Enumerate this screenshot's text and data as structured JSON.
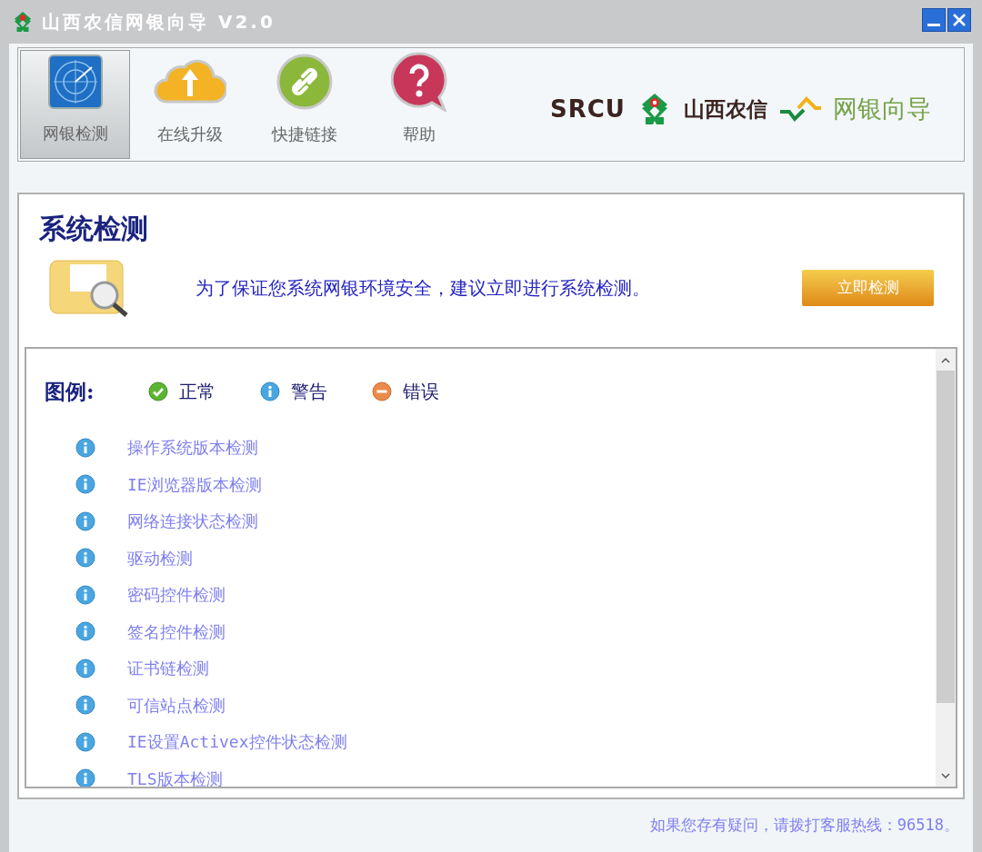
{
  "window": {
    "title": "山西农信网银向导 V2.0"
  },
  "tabs": [
    {
      "label": "网银检测",
      "selected": true,
      "kind": "radar"
    },
    {
      "label": "在线升级",
      "selected": false,
      "kind": "cloud"
    },
    {
      "label": "快捷链接",
      "selected": false,
      "kind": "link"
    },
    {
      "label": "帮助",
      "selected": false,
      "kind": "help"
    }
  ],
  "logo": {
    "brand": "SRCU",
    "name": "山西农信",
    "product": "网银向导"
  },
  "section": {
    "title": "系统检测",
    "message": "为了保证您系统网银环境安全，建议立即进行系统检测。",
    "button": "立即检测"
  },
  "legend": {
    "label": "图例:",
    "items": [
      {
        "kind": "ok",
        "label": "正常"
      },
      {
        "kind": "warning",
        "label": "警告"
      },
      {
        "kind": "error",
        "label": "错误"
      }
    ]
  },
  "checks": [
    {
      "kind": "warning",
      "label": "操作系统版本检测"
    },
    {
      "kind": "warning",
      "label": "IE浏览器版本检测"
    },
    {
      "kind": "warning",
      "label": "网络连接状态检测"
    },
    {
      "kind": "warning",
      "label": "驱动检测"
    },
    {
      "kind": "warning",
      "label": "密码控件检测"
    },
    {
      "kind": "warning",
      "label": "签名控件检测"
    },
    {
      "kind": "warning",
      "label": "证书链检测"
    },
    {
      "kind": "warning",
      "label": "可信站点检测"
    },
    {
      "kind": "warning",
      "label": "IE设置Activex控件状态检测"
    },
    {
      "kind": "warning",
      "label": "TLS版本检测"
    }
  ],
  "footer": "如果您存有疑问，请拨打客服热线：96518。"
}
